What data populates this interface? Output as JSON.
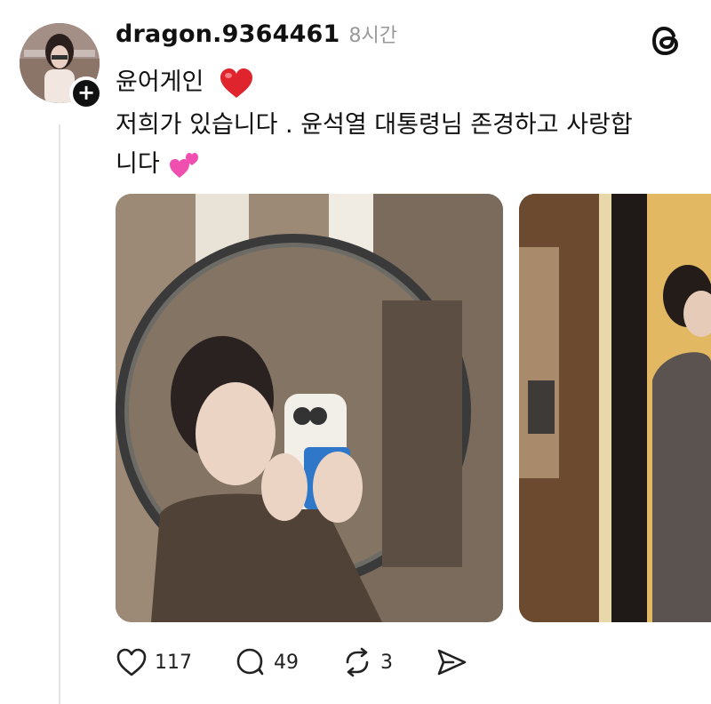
{
  "post": {
    "username": "dragon.9364461",
    "timestamp": "8시간",
    "line1": "윤어게인",
    "line2": "저희가 있습니다 . 윤석열 대통령님  존경하고 사랑합",
    "line3": "니다"
  },
  "actions": {
    "likes": "117",
    "comments": "49",
    "reposts": "3"
  },
  "icons": {
    "app": "threads-logo-icon",
    "like": "heart-icon",
    "comment": "comment-bubble-icon",
    "repost": "repost-icon",
    "share": "send-icon",
    "follow": "plus-icon"
  },
  "colors": {
    "heart": "#e0242e",
    "hearts_pink": "#f04fb0",
    "timestamp": "#999999"
  }
}
